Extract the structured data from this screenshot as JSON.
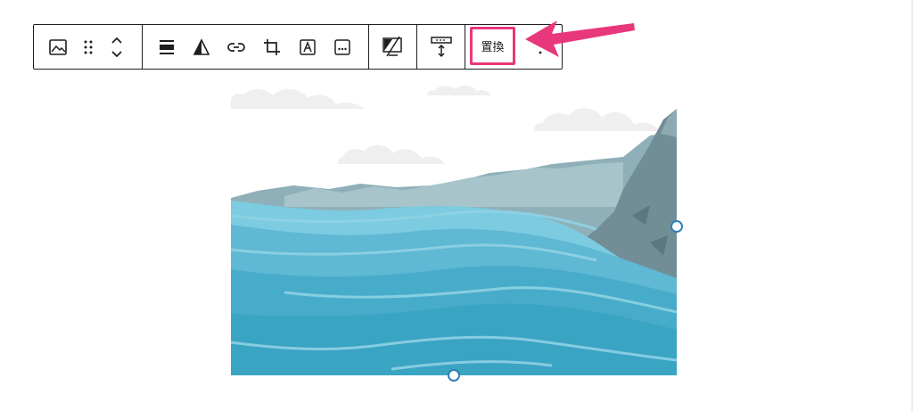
{
  "toolbar": {
    "replace_label": "置換",
    "icons": {
      "block_type": "image-icon",
      "drag": "drag-handle-icon",
      "move": "move-up-down-icon",
      "align": "align-icon",
      "duotone": "duotone-filter-icon",
      "link": "link-icon",
      "crop": "crop-icon",
      "text_overlay": "text-overlay-icon",
      "alt_text": "alt-text-icon",
      "cover": "apply-cover-icon",
      "height": "resize-height-icon",
      "options": "more-options-icon"
    }
  },
  "annotation": {
    "arrow_color": "#e8377a",
    "highlight_color": "#e8377a"
  },
  "image": {
    "subject": "sea-mountain-illustration",
    "colors": {
      "sea": "#3aa8c8",
      "sea_light": "#7ccbe0",
      "mountain": "#7f9ea6",
      "cliff": "#6d8a93",
      "cloud": "#eeeeee"
    }
  },
  "handles": {
    "color": "#2f80b5"
  }
}
